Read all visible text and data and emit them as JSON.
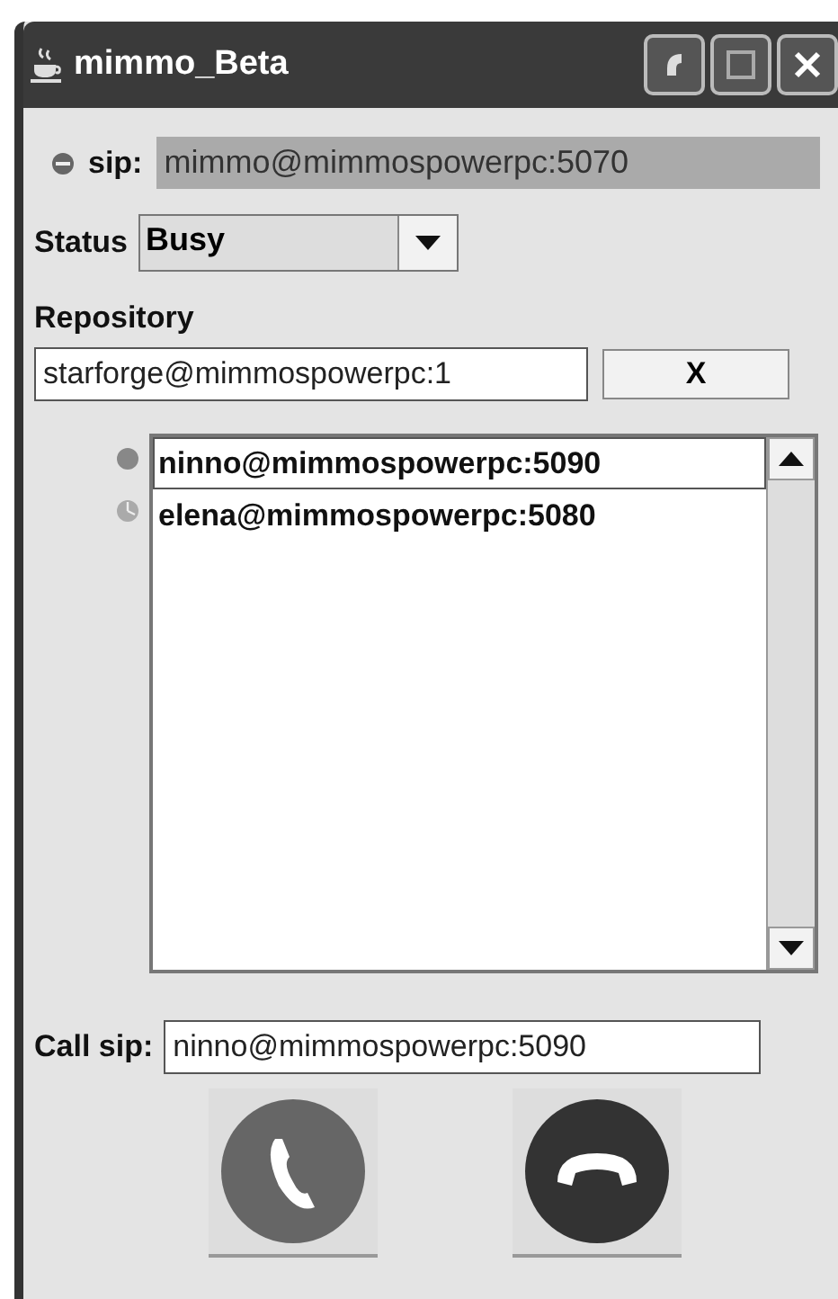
{
  "window": {
    "title": "mimmo_Beta"
  },
  "sip": {
    "label": "sip:",
    "value": "mimmo@mimmospowerpc:5070"
  },
  "status": {
    "label": "Status",
    "value": "Busy"
  },
  "repository": {
    "label": "Repository",
    "value": "starforge@mimmospowerpc:1",
    "button": "X"
  },
  "contacts": [
    {
      "name": "ninno@mimmospowerpc:5090",
      "selected": true
    },
    {
      "name": "elena@mimmospowerpc:5080",
      "selected": false
    }
  ],
  "call": {
    "label": "Call sip:",
    "value": "ninno@mimmospowerpc:5090"
  }
}
